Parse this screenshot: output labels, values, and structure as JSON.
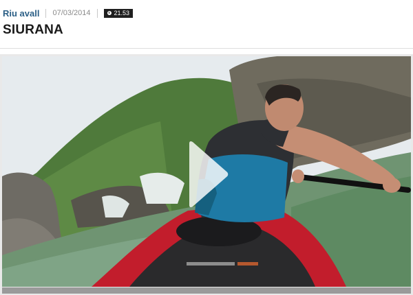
{
  "article": {
    "category": "Riu avall",
    "date": "07/03/2014",
    "duration": "21.53",
    "title": "SIURANA"
  },
  "player": {
    "play_icon": "play-icon",
    "progress_fraction": 0
  }
}
